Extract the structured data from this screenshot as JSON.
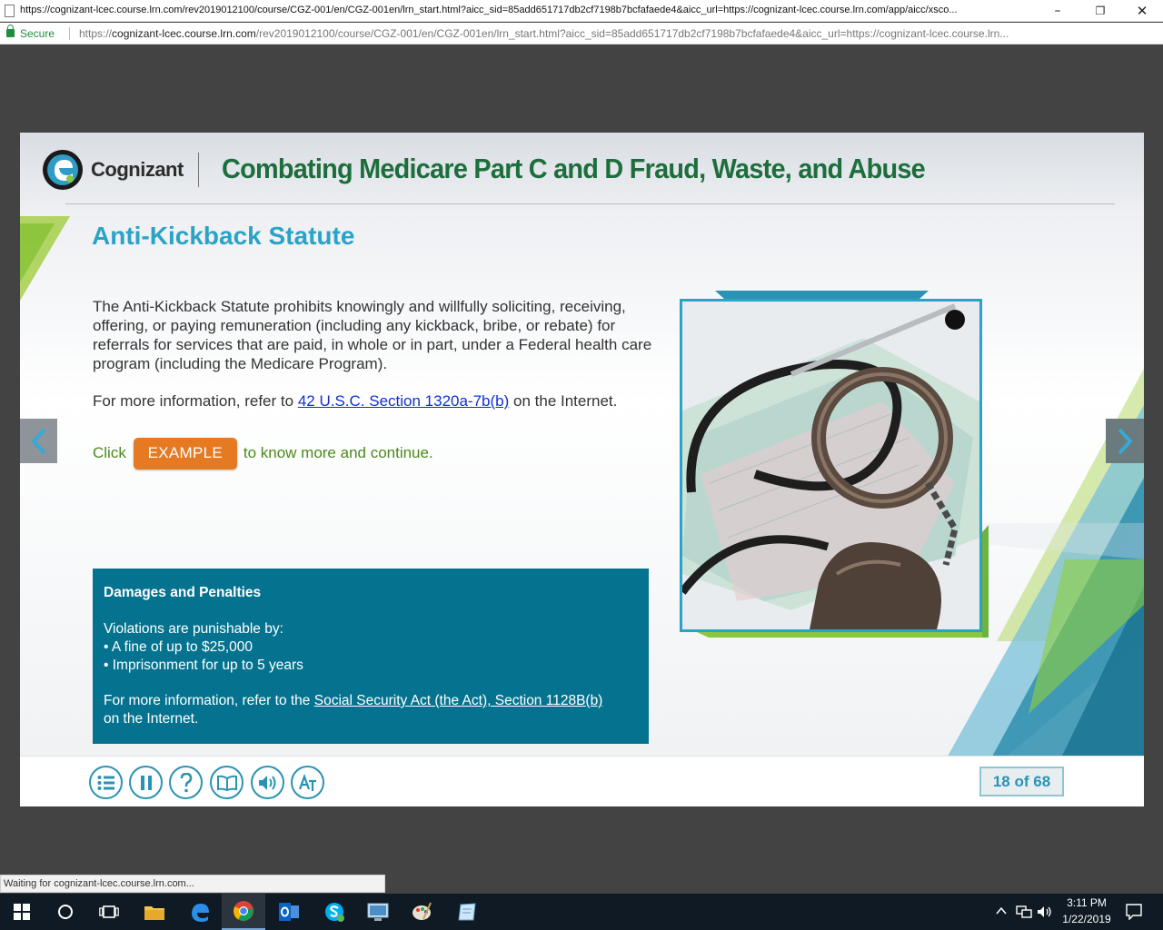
{
  "browser": {
    "window_title": "https://cognizant-lcec.course.lrn.com/rev2019012100/course/CGZ-001/en/CGZ-001en/lrn_start.html?aicc_sid=85add651717db2cf7198b7bcfafaede4&aicc_url=https://cognizant-lcec.course.lrn.com/app/aicc/xsco...",
    "secure_label": "Secure",
    "url_scheme": "https://",
    "url_host": "cognizant-lcec.course.lrn.com",
    "url_path": "/rev2019012100/course/CGZ-001/en/CGZ-001en/lrn_start.html?aicc_sid=85add651717db2cf7198b7bcfafaede4&aicc_url=https://cognizant-lcec.course.lrn...",
    "status_text": "Waiting for cognizant-lcec.course.lrn.com..."
  },
  "course": {
    "brand": "Cognizant",
    "title": "Combating Medicare Part C and D Fraud, Waste, and Abuse",
    "slide_title": "Anti-Kickback Statute",
    "body": "The Anti-Kickback Statute prohibits knowingly and willfully soliciting, receiving, offering, or paying remuneration (including any kickback, bribe, or rebate) for referrals for services that are paid, in whole or in part, under a Federal health care program (including the Medicare Program).",
    "more_info_prefix": "For more information, refer to ",
    "more_info_link": "42 U.S.C. Section 1320a-7b(b)",
    "more_info_suffix": " on the Internet.",
    "click_prefix": "Click",
    "example_button": "EXAMPLE",
    "click_suffix": "to know more and continue.",
    "box": {
      "heading": "Damages and Penalties",
      "intro": "Violations are punishable by:",
      "bullets": [
        "• A fine of up to $25,000",
        "• Imprisonment for up to 5 years"
      ],
      "ref_prefix": "For more information, refer to the ",
      "ref_link": "Social Security Act (the Act), Section 1128B(b)",
      "ref_suffix": "on the Internet."
    },
    "page_counter": "18 of 68",
    "controls": [
      "menu-icon",
      "pause-icon",
      "help-icon",
      "glossary-book-icon",
      "audio-icon",
      "text-transcript-icon"
    ]
  },
  "taskbar": {
    "time": "3:11 PM",
    "date": "1/22/2019",
    "apps": [
      "start",
      "search",
      "task-view",
      "file-explorer",
      "edge",
      "chrome",
      "outlook",
      "skype",
      "remote-desktop",
      "paint",
      "notes"
    ]
  },
  "colors": {
    "title_green": "#1d6e3c",
    "slide_title_blue": "#2aa3c6",
    "box_teal": "#05738f",
    "example_orange": "#e57a23",
    "link_blue": "#0e2fd6"
  }
}
